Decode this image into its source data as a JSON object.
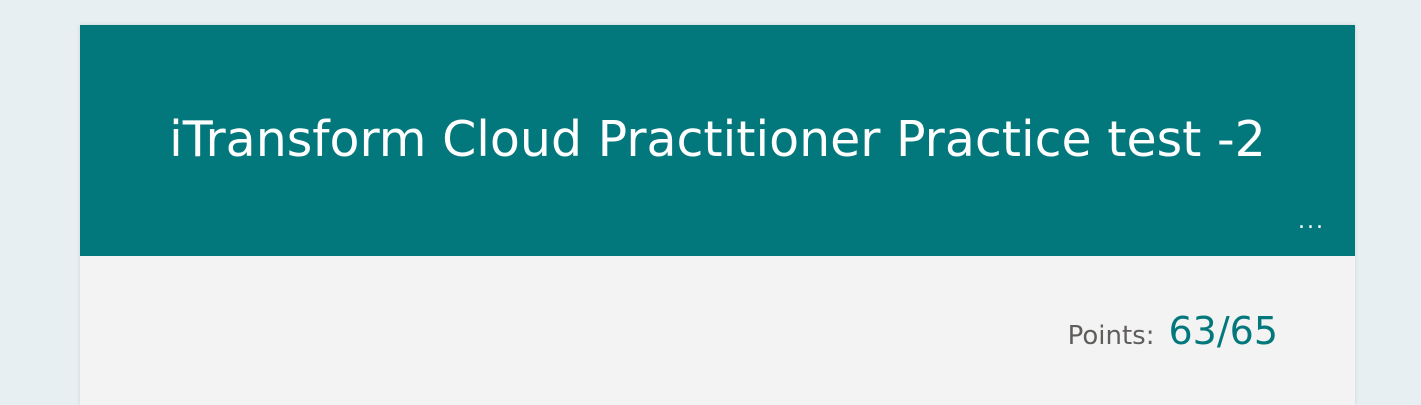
{
  "form": {
    "title": "iTransform Cloud Practitioner Practice test -2",
    "more_label": "...",
    "more_icon": "more-options-icon"
  },
  "score": {
    "label": "Points:",
    "value": "63/65"
  },
  "colors": {
    "page_background": "#e7eff2",
    "banner": "#03787c",
    "card": "#f3f3f3",
    "accent": "#03787c"
  }
}
